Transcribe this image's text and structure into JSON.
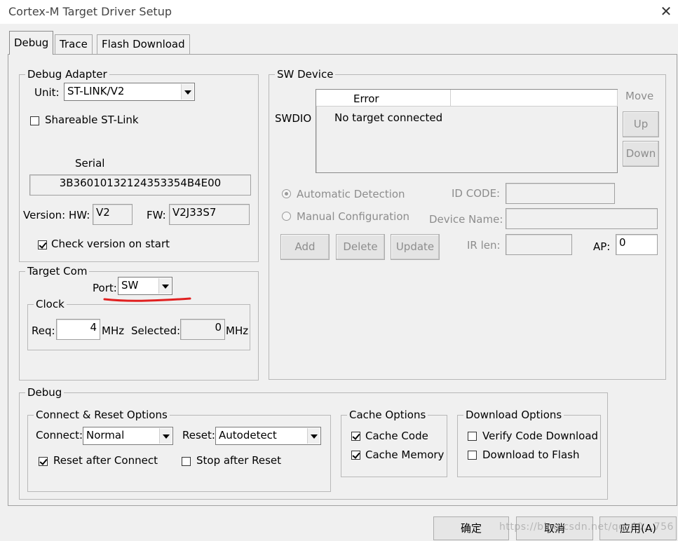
{
  "window": {
    "title": "Cortex-M Target Driver Setup"
  },
  "tabs": [
    {
      "label": "Debug",
      "active": true
    },
    {
      "label": "Trace",
      "active": false
    },
    {
      "label": "Flash Download",
      "active": false
    }
  ],
  "debug_adapter": {
    "title": "Debug Adapter",
    "unit_label": "Unit:",
    "unit_value": "ST-LINK/V2",
    "shareable_label": "Shareable ST-Link",
    "shareable_checked": false,
    "serial_label": "Serial",
    "serial_value": "3B36010132124353354B4E00",
    "version_label": "Version: HW:",
    "hw_value": "V2",
    "fw_label": "FW:",
    "fw_value": "V2J33S7",
    "check_version_label": "Check version on start",
    "check_version_checked": true
  },
  "target_com": {
    "title": "Target Com",
    "port_label": "Port:",
    "port_value": "SW",
    "clock": {
      "title": "Clock",
      "req_label": "Req:",
      "req_value": "4",
      "req_unit": "MHz",
      "selected_label": "Selected:",
      "selected_value": "0",
      "selected_unit": "MHz"
    }
  },
  "sw_device": {
    "title": "SW Device",
    "row_label": "SWDIO",
    "header_error": "Error",
    "row_value": "No target connected",
    "move_label": "Move",
    "up_label": "Up",
    "down_label": "Down",
    "auto_detect_label": "Automatic Detection",
    "manual_config_label": "Manual Configuration",
    "id_code_label": "ID CODE:",
    "device_name_label": "Device Name:",
    "ir_len_label": "IR len:",
    "ap_label": "AP:",
    "ap_value": "0",
    "add_label": "Add",
    "delete_label": "Delete",
    "update_label": "Update"
  },
  "debug": {
    "title": "Debug",
    "connect_reset": {
      "title": "Connect & Reset Options",
      "connect_label": "Connect:",
      "connect_value": "Normal",
      "reset_label": "Reset:",
      "reset_value": "Autodetect",
      "reset_after_connect_label": "Reset after Connect",
      "reset_after_connect_checked": true,
      "stop_after_reset_label": "Stop after Reset",
      "stop_after_reset_checked": false
    },
    "cache": {
      "title": "Cache Options",
      "cache_code_label": "Cache Code",
      "cache_code_checked": true,
      "cache_memory_label": "Cache Memory",
      "cache_memory_checked": true
    },
    "download": {
      "title": "Download Options",
      "verify_label": "Verify Code Download",
      "verify_checked": false,
      "download_flash_label": "Download to Flash",
      "download_flash_checked": false
    }
  },
  "footer": {
    "ok_label": "确定",
    "cancel_label": "取消",
    "apply_label": "应用(A)",
    "watermark": "https://blog.csdn.net/qq_40...756"
  },
  "colors": {
    "annotation_red": "#e02020"
  }
}
